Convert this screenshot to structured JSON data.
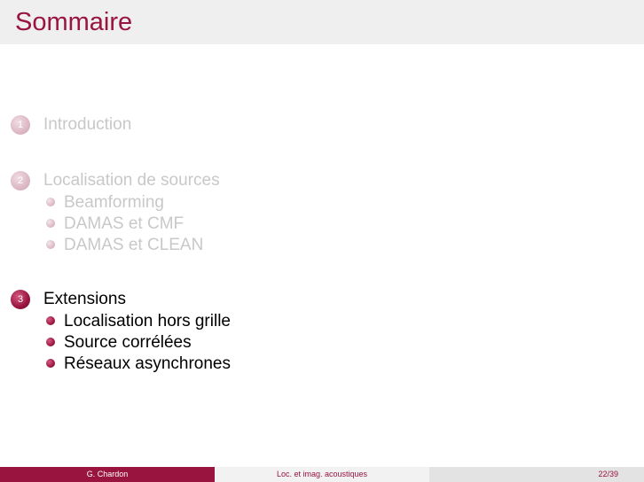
{
  "frame_title": "Sommaire",
  "toc": [
    {
      "number": "1",
      "title": "Introduction",
      "state": "shaded",
      "subsections": []
    },
    {
      "number": "2",
      "title": "Localisation de sources",
      "state": "shaded",
      "subsections": [
        "Beamforming",
        "DAMAS et CMF",
        "DAMAS et CLEAN"
      ]
    },
    {
      "number": "3",
      "title": "Extensions",
      "state": "active",
      "subsections": [
        "Localisation hors grille",
        "Source corrélées",
        "Réseaux asynchrones"
      ]
    }
  ],
  "footer": {
    "author": "G. Chardon",
    "short_title": "Loc. et imag. acoustiques",
    "page": "22/39"
  },
  "colors": {
    "accent": "#99143f",
    "title_bar": "#efefef",
    "shaded_text": "#c8c8c8"
  }
}
